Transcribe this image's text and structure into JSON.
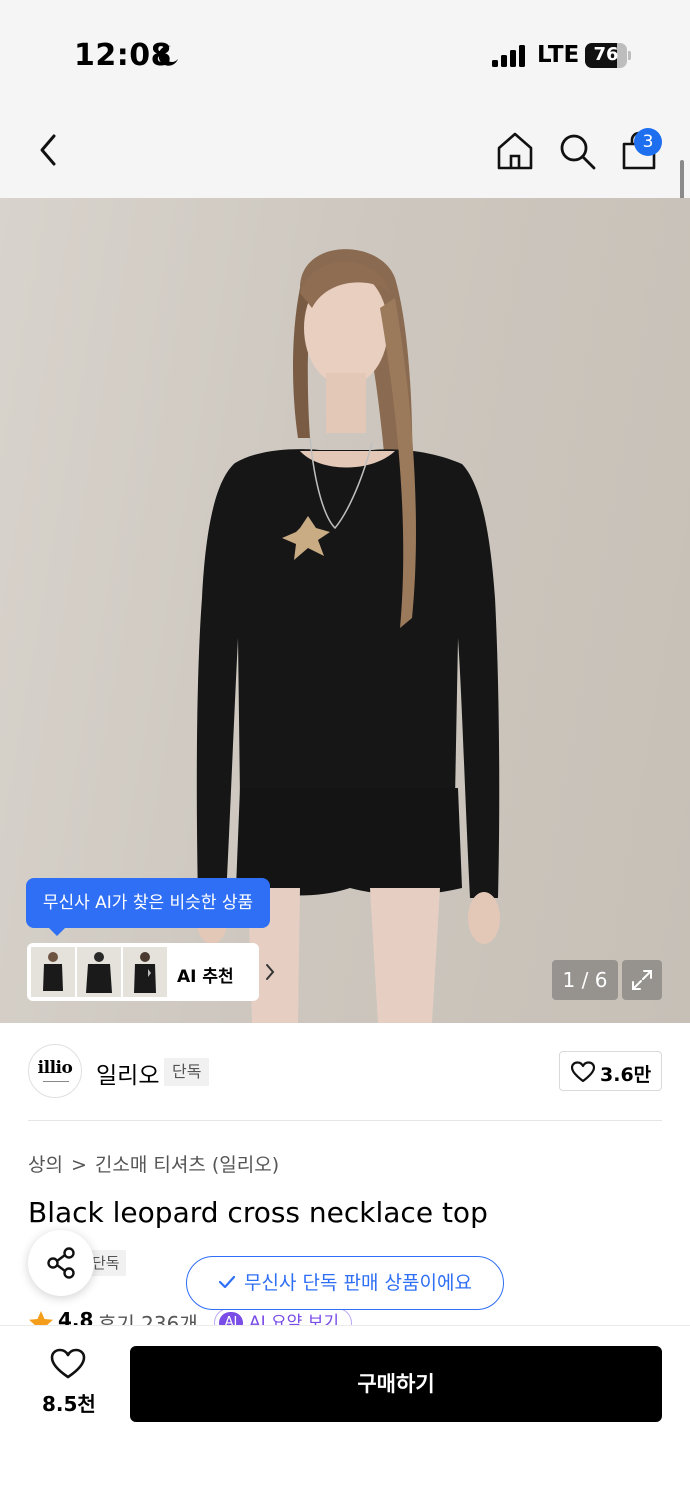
{
  "status_bar": {
    "time": "12:08",
    "network": "LTE",
    "battery": "76",
    "battery_level": 0.76
  },
  "nav": {
    "cart_count": "3"
  },
  "gallery": {
    "ai_tooltip": "무신사 AI가 찾은 비슷한 상품",
    "ai_recommend_label": "AI 추천",
    "page_indicator": "1 / 6"
  },
  "brand": {
    "logo_text": "illio",
    "name": "일리오",
    "exclusive_tag": "단독",
    "likes": "3.6만"
  },
  "product": {
    "breadcrumb": [
      "상의",
      "긴소매 티셔츠 (일리오)"
    ],
    "title": "Black leopard cross necklace top",
    "tag": "단독",
    "exclusive_notice": "무신사 단독 판매 상품이에요",
    "rating": "4.8",
    "reviews": "후기 236개",
    "ai_summary_chip": "AI",
    "ai_summary": "AI 요약 보기"
  },
  "bottom_bar": {
    "favorites": "8.5천",
    "buy_label": "구매하기"
  },
  "colors": {
    "accent_blue": "#2f6ff5",
    "badge_blue": "#1e6ff0",
    "ai_purple": "#7a4de6",
    "star": "#f59e1b",
    "buy_button": "#000000"
  }
}
